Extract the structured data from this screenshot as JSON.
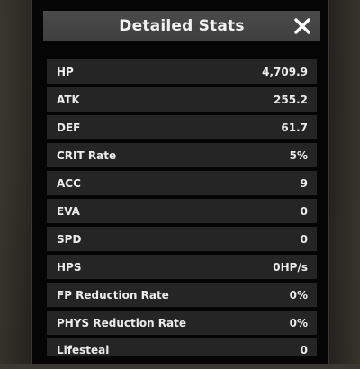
{
  "dialog": {
    "title": "Detailed Stats",
    "close_icon": "close-icon"
  },
  "stats": [
    {
      "label": "HP",
      "value": "4,709.9"
    },
    {
      "label": "ATK",
      "value": "255.2"
    },
    {
      "label": "DEF",
      "value": "61.7"
    },
    {
      "label": "CRIT Rate",
      "value": "5%"
    },
    {
      "label": "ACC",
      "value": "9"
    },
    {
      "label": "EVA",
      "value": "0"
    },
    {
      "label": "SPD",
      "value": "0"
    },
    {
      "label": "HPS",
      "value": "0HP/s"
    },
    {
      "label": "FP Reduction Rate",
      "value": "0%"
    },
    {
      "label": "PHYS Reduction Rate",
      "value": "0%"
    },
    {
      "label": "Lifesteal",
      "value": "0"
    }
  ],
  "colors": {
    "panel_bg": "#050505",
    "title_bar_bg": "#454545",
    "row_bg": "#252526",
    "text": "#ececec"
  }
}
